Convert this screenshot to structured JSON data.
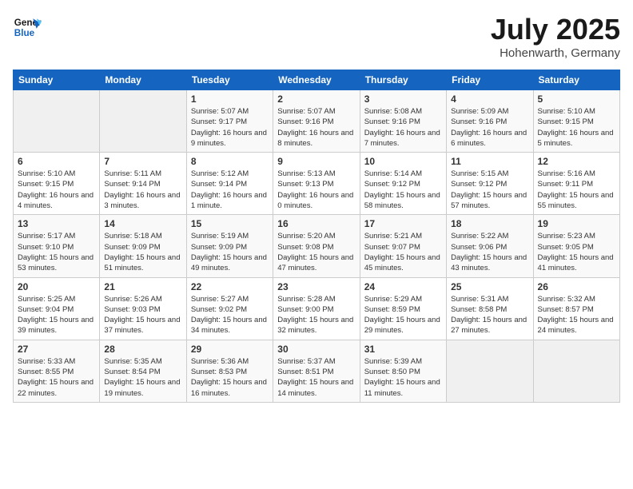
{
  "header": {
    "logo_line1": "General",
    "logo_line2": "Blue",
    "month_title": "July 2025",
    "location": "Hohenwarth, Germany"
  },
  "weekdays": [
    "Sunday",
    "Monday",
    "Tuesday",
    "Wednesday",
    "Thursday",
    "Friday",
    "Saturday"
  ],
  "weeks": [
    [
      {
        "day": "",
        "info": ""
      },
      {
        "day": "",
        "info": ""
      },
      {
        "day": "1",
        "info": "Sunrise: 5:07 AM\nSunset: 9:17 PM\nDaylight: 16 hours and 9 minutes."
      },
      {
        "day": "2",
        "info": "Sunrise: 5:07 AM\nSunset: 9:16 PM\nDaylight: 16 hours and 8 minutes."
      },
      {
        "day": "3",
        "info": "Sunrise: 5:08 AM\nSunset: 9:16 PM\nDaylight: 16 hours and 7 minutes."
      },
      {
        "day": "4",
        "info": "Sunrise: 5:09 AM\nSunset: 9:16 PM\nDaylight: 16 hours and 6 minutes."
      },
      {
        "day": "5",
        "info": "Sunrise: 5:10 AM\nSunset: 9:15 PM\nDaylight: 16 hours and 5 minutes."
      }
    ],
    [
      {
        "day": "6",
        "info": "Sunrise: 5:10 AM\nSunset: 9:15 PM\nDaylight: 16 hours and 4 minutes."
      },
      {
        "day": "7",
        "info": "Sunrise: 5:11 AM\nSunset: 9:14 PM\nDaylight: 16 hours and 3 minutes."
      },
      {
        "day": "8",
        "info": "Sunrise: 5:12 AM\nSunset: 9:14 PM\nDaylight: 16 hours and 1 minute."
      },
      {
        "day": "9",
        "info": "Sunrise: 5:13 AM\nSunset: 9:13 PM\nDaylight: 16 hours and 0 minutes."
      },
      {
        "day": "10",
        "info": "Sunrise: 5:14 AM\nSunset: 9:12 PM\nDaylight: 15 hours and 58 minutes."
      },
      {
        "day": "11",
        "info": "Sunrise: 5:15 AM\nSunset: 9:12 PM\nDaylight: 15 hours and 57 minutes."
      },
      {
        "day": "12",
        "info": "Sunrise: 5:16 AM\nSunset: 9:11 PM\nDaylight: 15 hours and 55 minutes."
      }
    ],
    [
      {
        "day": "13",
        "info": "Sunrise: 5:17 AM\nSunset: 9:10 PM\nDaylight: 15 hours and 53 minutes."
      },
      {
        "day": "14",
        "info": "Sunrise: 5:18 AM\nSunset: 9:09 PM\nDaylight: 15 hours and 51 minutes."
      },
      {
        "day": "15",
        "info": "Sunrise: 5:19 AM\nSunset: 9:09 PM\nDaylight: 15 hours and 49 minutes."
      },
      {
        "day": "16",
        "info": "Sunrise: 5:20 AM\nSunset: 9:08 PM\nDaylight: 15 hours and 47 minutes."
      },
      {
        "day": "17",
        "info": "Sunrise: 5:21 AM\nSunset: 9:07 PM\nDaylight: 15 hours and 45 minutes."
      },
      {
        "day": "18",
        "info": "Sunrise: 5:22 AM\nSunset: 9:06 PM\nDaylight: 15 hours and 43 minutes."
      },
      {
        "day": "19",
        "info": "Sunrise: 5:23 AM\nSunset: 9:05 PM\nDaylight: 15 hours and 41 minutes."
      }
    ],
    [
      {
        "day": "20",
        "info": "Sunrise: 5:25 AM\nSunset: 9:04 PM\nDaylight: 15 hours and 39 minutes."
      },
      {
        "day": "21",
        "info": "Sunrise: 5:26 AM\nSunset: 9:03 PM\nDaylight: 15 hours and 37 minutes."
      },
      {
        "day": "22",
        "info": "Sunrise: 5:27 AM\nSunset: 9:02 PM\nDaylight: 15 hours and 34 minutes."
      },
      {
        "day": "23",
        "info": "Sunrise: 5:28 AM\nSunset: 9:00 PM\nDaylight: 15 hours and 32 minutes."
      },
      {
        "day": "24",
        "info": "Sunrise: 5:29 AM\nSunset: 8:59 PM\nDaylight: 15 hours and 29 minutes."
      },
      {
        "day": "25",
        "info": "Sunrise: 5:31 AM\nSunset: 8:58 PM\nDaylight: 15 hours and 27 minutes."
      },
      {
        "day": "26",
        "info": "Sunrise: 5:32 AM\nSunset: 8:57 PM\nDaylight: 15 hours and 24 minutes."
      }
    ],
    [
      {
        "day": "27",
        "info": "Sunrise: 5:33 AM\nSunset: 8:55 PM\nDaylight: 15 hours and 22 minutes."
      },
      {
        "day": "28",
        "info": "Sunrise: 5:35 AM\nSunset: 8:54 PM\nDaylight: 15 hours and 19 minutes."
      },
      {
        "day": "29",
        "info": "Sunrise: 5:36 AM\nSunset: 8:53 PM\nDaylight: 15 hours and 16 minutes."
      },
      {
        "day": "30",
        "info": "Sunrise: 5:37 AM\nSunset: 8:51 PM\nDaylight: 15 hours and 14 minutes."
      },
      {
        "day": "31",
        "info": "Sunrise: 5:39 AM\nSunset: 8:50 PM\nDaylight: 15 hours and 11 minutes."
      },
      {
        "day": "",
        "info": ""
      },
      {
        "day": "",
        "info": ""
      }
    ]
  ]
}
